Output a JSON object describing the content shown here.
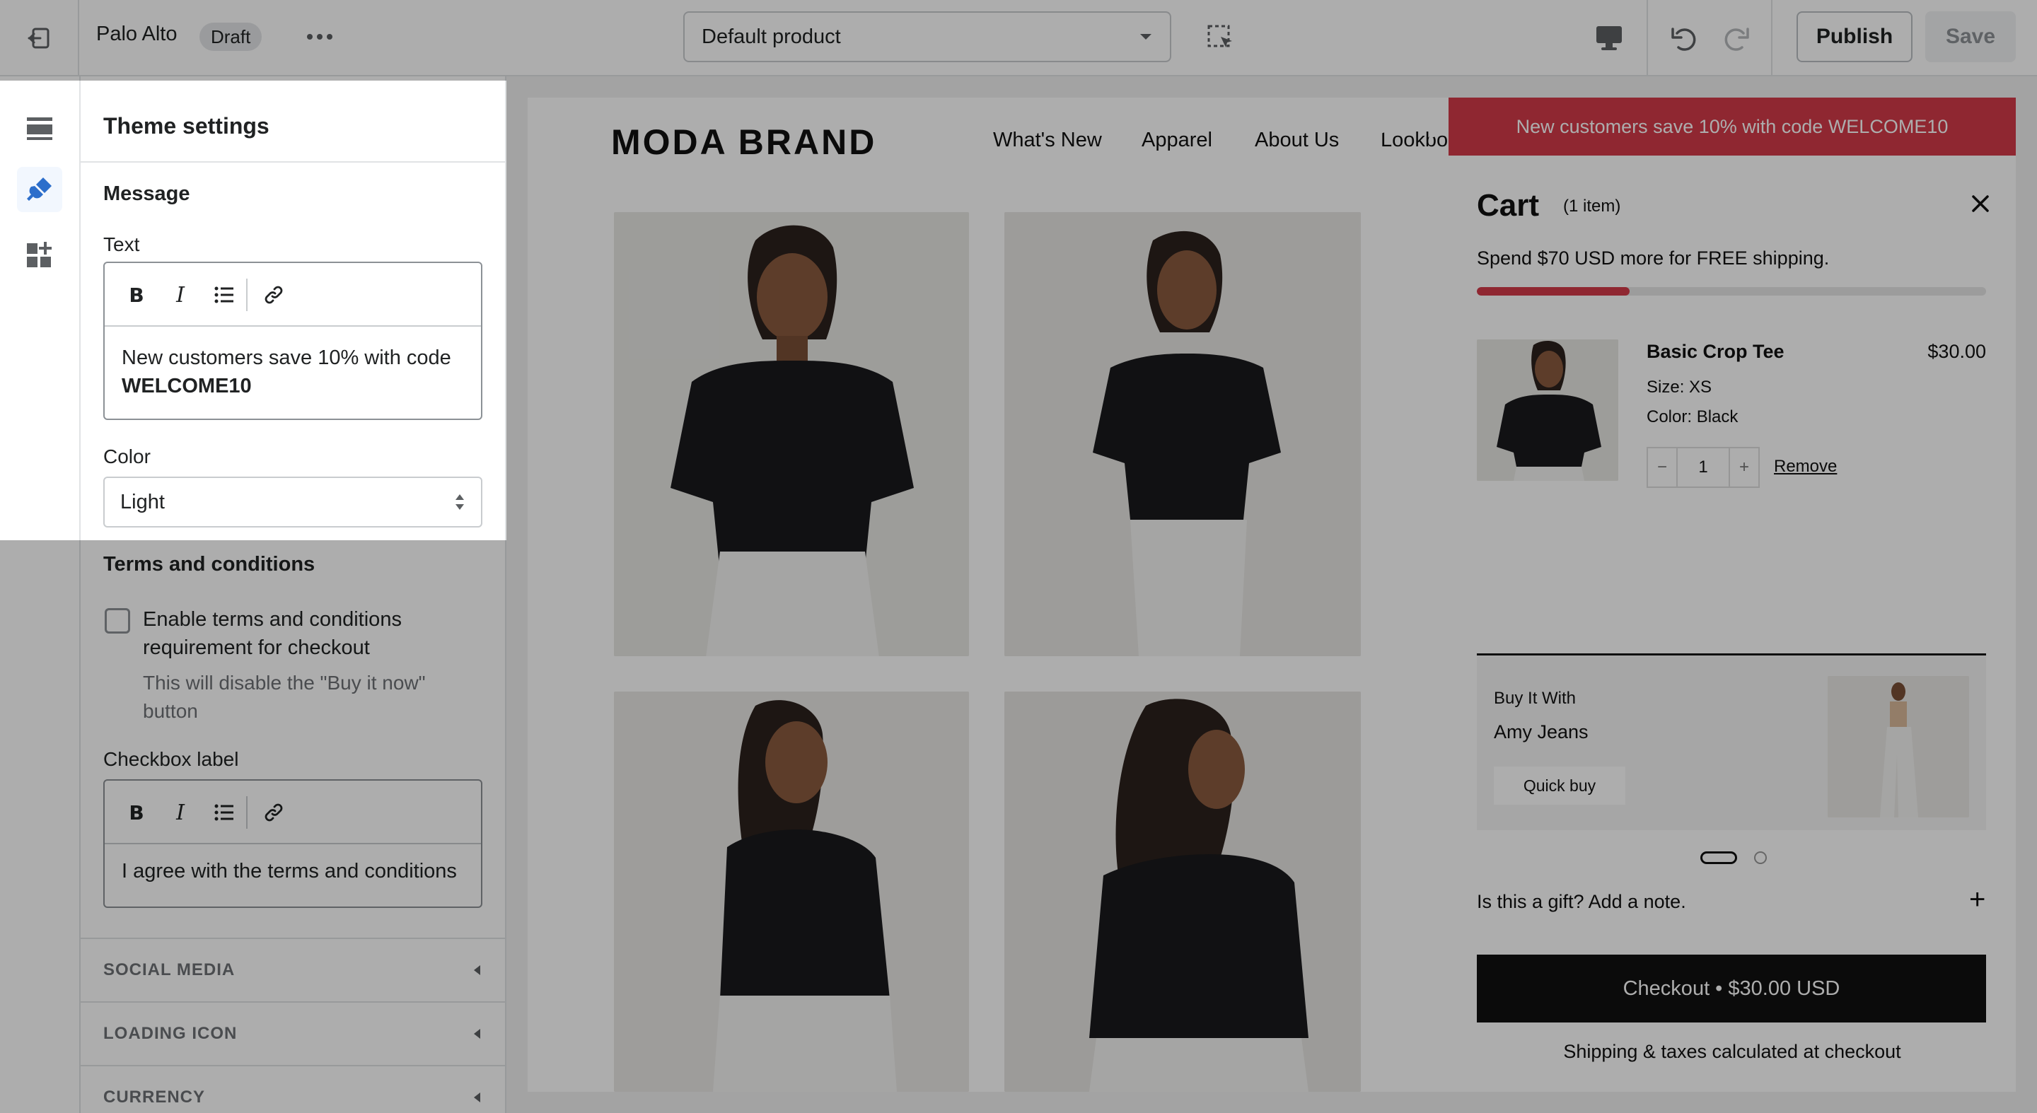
{
  "topbar": {
    "theme_name": "Palo Alto",
    "status_badge": "Draft",
    "template_select": "Default product",
    "publish_label": "Publish",
    "save_label": "Save"
  },
  "icons": {
    "exit": "exit-icon",
    "more": "more-horizontal-icon",
    "dropdown": "chevron-down-icon",
    "inspector": "select-element-icon",
    "desktop": "desktop-icon",
    "undo": "undo-icon",
    "redo": "redo-icon",
    "sections": "sections-icon",
    "theme_settings": "paint-brush-icon",
    "app_embeds": "app-embeds-icon"
  },
  "panel": {
    "title": "Theme settings",
    "message": {
      "heading": "Message",
      "text_label": "Text",
      "text_plain": "New customers save 10% with code",
      "text_bold": "WELCOME10",
      "color_label": "Color",
      "color_value": "Light"
    },
    "terms": {
      "heading": "Terms and conditions",
      "checkbox_label": "Enable terms and conditions requirement for checkout",
      "checkbox_checked": false,
      "help": "This will disable the \"Buy it now\" button",
      "checkbox_label_field_label": "Checkbox label",
      "checkbox_label_value": "I agree with the terms and conditions"
    },
    "collapsed_sections": [
      "SOCIAL MEDIA",
      "LOADING ICON",
      "CURRENCY"
    ],
    "rte_tools": [
      "B",
      "I"
    ]
  },
  "preview": {
    "brand": "MODA BRAND",
    "nav": [
      "What's New",
      "Apparel",
      "About Us",
      "Lookbo"
    ],
    "cart": {
      "announcement": "New customers save 10% with code WELCOME10",
      "title": "Cart",
      "count": "(1 item)",
      "shipping_message": "Spend $70 USD more for FREE shipping.",
      "shipping_progress": 0.3,
      "item": {
        "name": "Basic Crop Tee",
        "price": "$30.00",
        "size": "Size: XS",
        "color": "Color: Black",
        "qty_minus": "−",
        "quantity": "1",
        "qty_plus": "+",
        "remove": "Remove"
      },
      "upsell": {
        "label": "Buy It With",
        "name": "Amy Jeans",
        "button": "Quick buy"
      },
      "gift_note": "Is this a gift? Add a note.",
      "gift_plus": "+",
      "checkout": "Checkout • $30.00 USD",
      "shipping_note": "Shipping & taxes calculated at checkout"
    }
  },
  "colors": {
    "accent_blue": "#2c6ecb",
    "announcement_red": "#d33a49",
    "checkout_black": "#111111"
  }
}
